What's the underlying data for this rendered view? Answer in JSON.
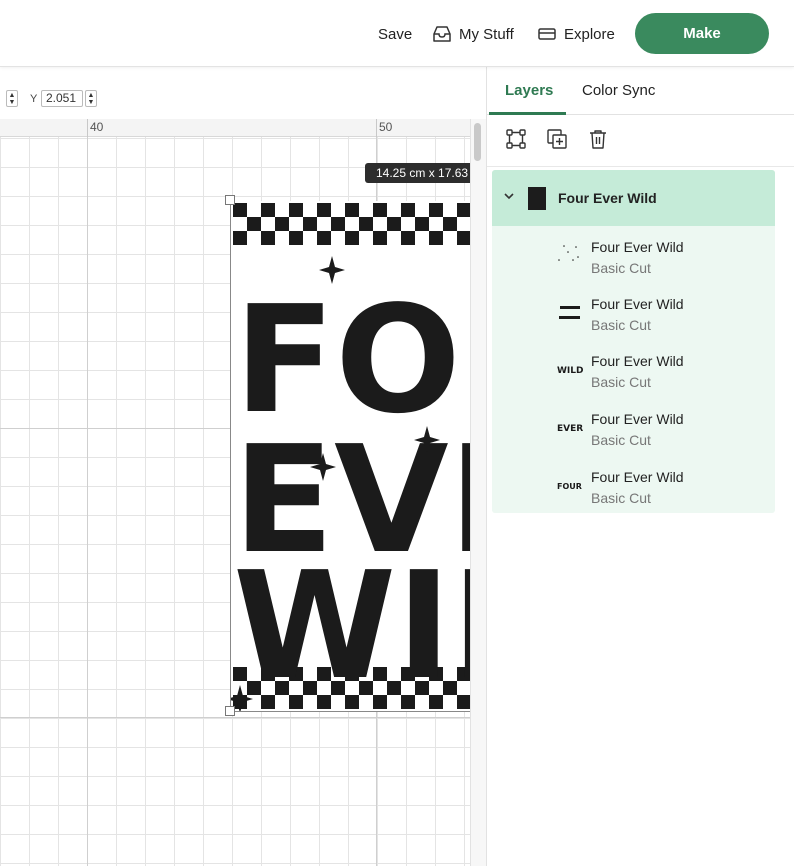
{
  "header": {
    "save_label": "Save",
    "mystuff_label": "My Stuff",
    "explore_label": "Explore",
    "make_label": "Make",
    "accent_color": "#3a8a5e"
  },
  "position": {
    "y_label": "Y",
    "y_value": "2.051"
  },
  "ruler": {
    "labels": [
      "40",
      "50"
    ]
  },
  "canvas": {
    "size_readout": "14.25  cm x 17.63"
  },
  "design": {
    "words": [
      "FOUR",
      "EVER",
      "WILD"
    ]
  },
  "panel": {
    "tabs": [
      {
        "label": "Layers",
        "active": true
      },
      {
        "label": "Color Sync",
        "active": false
      }
    ],
    "tool_icons": [
      "group-icon",
      "duplicate-icon",
      "delete-icon"
    ],
    "group": {
      "name": "Four Ever Wild",
      "expanded": true,
      "layers": [
        {
          "name": "Four Ever Wild",
          "type": "Basic Cut",
          "thumb": "dots"
        },
        {
          "name": "Four Ever Wild",
          "type": "Basic Cut",
          "thumb": "lines"
        },
        {
          "name": "Four Ever Wild",
          "type": "Basic Cut",
          "thumb": "WILD"
        },
        {
          "name": "Four Ever Wild",
          "type": "Basic Cut",
          "thumb": "EVER"
        },
        {
          "name": "Four Ever Wild",
          "type": "Basic Cut",
          "thumb": "FOUR"
        }
      ]
    }
  }
}
